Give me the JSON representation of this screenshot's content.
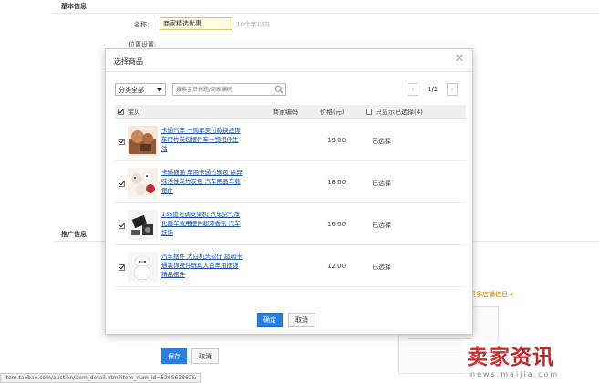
{
  "background": {
    "section_title": "基本信息",
    "name_label": "名称:",
    "name_value": "商家精选优惠",
    "name_hint": "10个字以内",
    "row2_label": "位置设置:",
    "promo_section": "推广信息",
    "save_label": "保存",
    "cancel_label": "取消",
    "status_url": "item.taobao.com/auction/item_detail.htm?item_num_id=526563862&",
    "tag_text": "更多店铺信息 ▾"
  },
  "modal": {
    "title": "选择商品",
    "category": "分类全部",
    "search_placeholder": "搜索宝贝标题/商家编码",
    "pager": {
      "prev": "‹",
      "text": "1/1",
      "next": "›"
    },
    "headers": {
      "item": "宝贝",
      "code": "商家编码",
      "price": "价格(元)",
      "only_selected": "只显示已选择(4)"
    },
    "rows": [
      {
        "title": "卡通汽车 一周年实付款换挂饰 车用竹炭包摆件车一物相伴生活",
        "price": "19.00",
        "status": "已选择"
      },
      {
        "title": "卡通猫猫 车用卡通竹炭包 除异味活性炭竹炭包 汽车用品车载摆件",
        "price": "18.00",
        "status": "已选择"
      },
      {
        "title": "135度可调支架机 汽车空气净化器车载用摆件超薄香氛 汽车挂饰",
        "price": "16.00",
        "status": "已选择"
      },
      {
        "title": "汽车摆件 大白机头公仔 超萌卡通装饰挂件玩具大白车用摆饰精品摆件",
        "price": "12.00",
        "status": "已选择"
      }
    ],
    "ok_label": "确定",
    "cancel_label": "取消"
  },
  "watermark": {
    "cn_a": "卖家",
    "cn_b": "资讯",
    "en": "news.maijia.com"
  }
}
